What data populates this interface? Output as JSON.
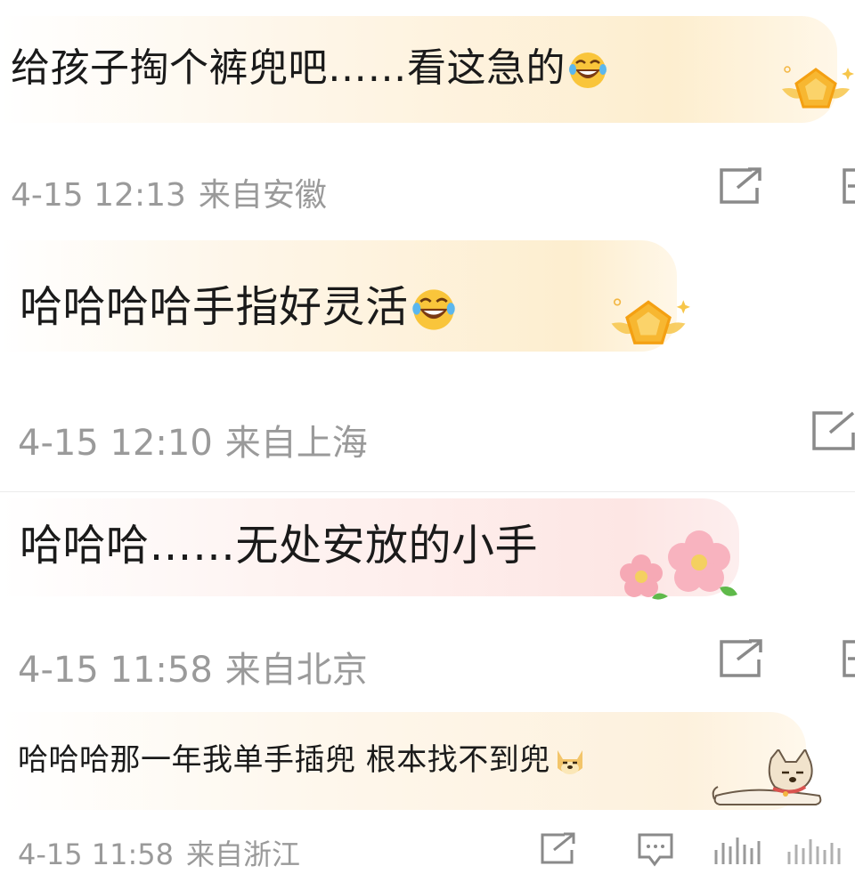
{
  "comments": [
    {
      "text": "给孩子掏个裤兜吧……看这急的",
      "date": "4-15 12:13",
      "location": "来自安徽",
      "emoji": "laugh-cry-emoji",
      "decoration": "gold-badge"
    },
    {
      "text": "哈哈哈哈手指好灵活",
      "date": "4-15 12:10",
      "location": "来自上海",
      "emoji": "laugh-cry-emoji",
      "decoration": "gold-badge"
    },
    {
      "text": "哈哈哈……无处安放的小手",
      "date": "4-15 11:58",
      "location": "来自北京",
      "decoration": "pink-flowers"
    },
    {
      "text": "哈哈哈那一年我单手插兜 根本找不到兜",
      "date": "4-15 11:58",
      "location": "来自浙江",
      "emoji": "doge-emoji",
      "decoration": "lying-dog"
    }
  ],
  "icons": {
    "repost": "repost-icon",
    "comment": "comment-icon",
    "like": "like-icon",
    "more": "more-icon"
  },
  "colors": {
    "text": "#1a1a1a",
    "meta": "#9a9a9a",
    "bubble_gold": "#fdf1dc",
    "bubble_pink": "#fde8e8",
    "icon": "#8a8a8a"
  }
}
